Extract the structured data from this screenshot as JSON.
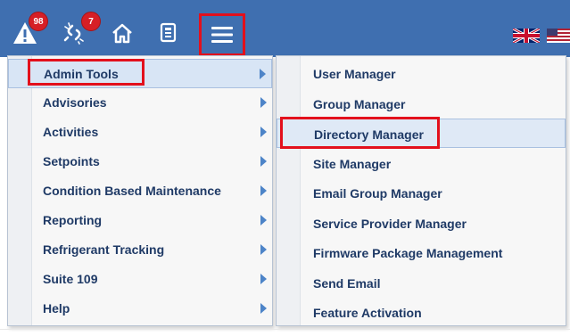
{
  "toolbar": {
    "alerts_badge": "98",
    "disconnected_badge": "7",
    "icons": [
      "warning-icon",
      "unlink-icon",
      "home-icon",
      "report-icon",
      "hamburger-menu-icon"
    ]
  },
  "flags": [
    "uk-flag-icon",
    "us-flag-icon"
  ],
  "menu": {
    "items": [
      {
        "label": "Admin Tools"
      },
      {
        "label": "Advisories"
      },
      {
        "label": "Activities"
      },
      {
        "label": "Setpoints"
      },
      {
        "label": "Condition Based Maintenance"
      },
      {
        "label": "Reporting"
      },
      {
        "label": "Refrigerant Tracking"
      },
      {
        "label": "Suite 109"
      },
      {
        "label": "Help"
      }
    ]
  },
  "submenu": {
    "items": [
      {
        "label": "User Manager"
      },
      {
        "label": "Group Manager"
      },
      {
        "label": "Directory Manager"
      },
      {
        "label": "Site Manager"
      },
      {
        "label": "Email Group Manager"
      },
      {
        "label": "Service Provider Manager"
      },
      {
        "label": "Firmware Package Management"
      },
      {
        "label": "Send Email"
      },
      {
        "label": "Feature Activation"
      }
    ]
  },
  "colors": {
    "toolbar_bg": "#3f6fb0",
    "badge": "#d61f26",
    "highlight_border": "#e3101c",
    "menu_text": "#1f3a66"
  }
}
